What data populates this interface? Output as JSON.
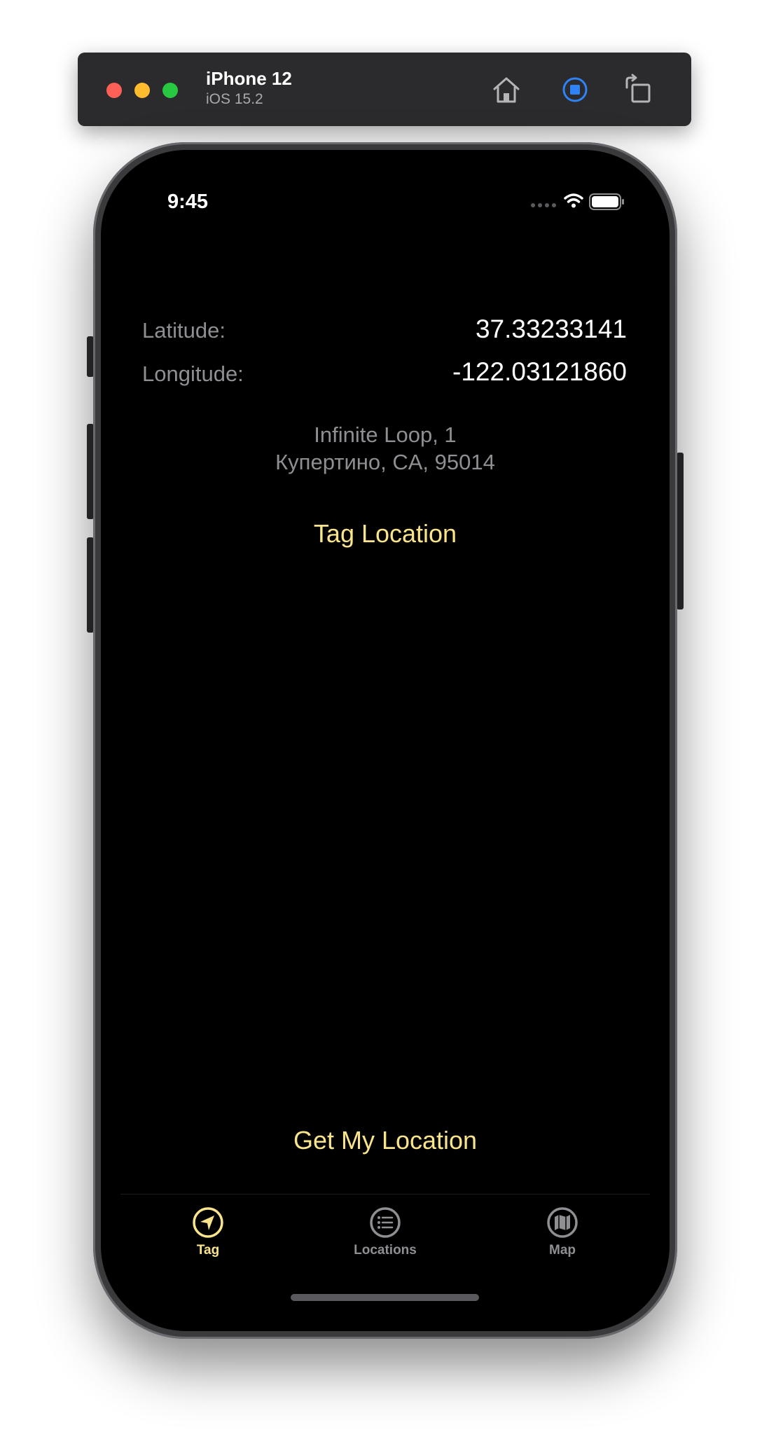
{
  "simulator": {
    "device_name": "iPhone 12",
    "os_version": "iOS 15.2",
    "icons": [
      "home-icon",
      "screenshot-icon",
      "rotate-icon"
    ]
  },
  "status_bar": {
    "time": "9:45",
    "icons": [
      "signal-dots-icon",
      "wifi-icon",
      "battery-icon"
    ]
  },
  "location": {
    "latitude_label": "Latitude:",
    "latitude_value": "37.33233141",
    "longitude_label": "Longitude:",
    "longitude_value": "-122.03121860",
    "address_line1": "Infinite Loop, 1",
    "address_line2": "Купертино, CA, 95014"
  },
  "actions": {
    "tag_location": "Tag Location",
    "get_my_location": "Get My Location"
  },
  "tabs": [
    {
      "label": "Tag",
      "icon": "location-arrow-icon",
      "active": true
    },
    {
      "label": "Locations",
      "icon": "list-icon",
      "active": false
    },
    {
      "label": "Map",
      "icon": "map-icon",
      "active": false
    }
  ],
  "colors": {
    "accent": "#f9e48c",
    "background": "#000000",
    "secondary_text": "#8e8e93",
    "primary_text": "#ffffff"
  }
}
